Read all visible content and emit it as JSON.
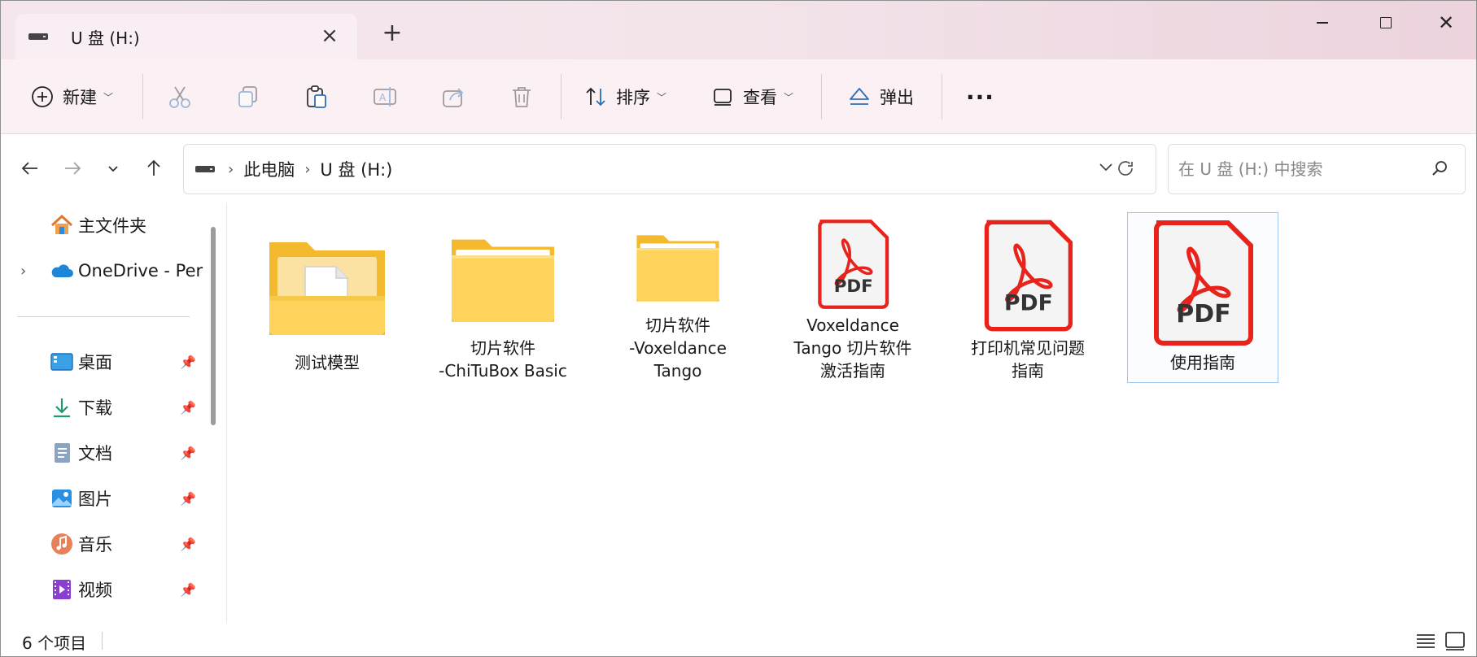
{
  "window": {
    "tab_title": "U 盘 (H:)",
    "icons": {
      "tab_close": "close-icon",
      "new_tab": "plus-icon"
    }
  },
  "toolbar": {
    "new_label": "新建",
    "sort_label": "排序",
    "view_label": "查看",
    "eject_label": "弹出",
    "more_label": "···",
    "icons": [
      "plus-circle-icon",
      "cut-icon",
      "copy-icon",
      "paste-icon",
      "rename-icon",
      "share-icon",
      "delete-icon",
      "sort-icon",
      "view-icon",
      "eject-icon",
      "more-icon"
    ]
  },
  "address": {
    "crumbs": [
      "此电脑",
      "U 盘 (H:)"
    ],
    "search_placeholder": "在 U 盘 (H:) 中搜索"
  },
  "sidebar": {
    "items": [
      {
        "label": "主文件夹",
        "icon": "home-icon",
        "pinned": false
      },
      {
        "label": "OneDrive - Per",
        "icon": "cloud-icon",
        "pinned": false
      },
      {
        "label": "桌面",
        "icon": "desktop-icon",
        "pinned": true
      },
      {
        "label": "下载",
        "icon": "download-icon",
        "pinned": true
      },
      {
        "label": "文档",
        "icon": "document-icon",
        "pinned": true
      },
      {
        "label": "图片",
        "icon": "pictures-icon",
        "pinned": true
      },
      {
        "label": "音乐",
        "icon": "music-icon",
        "pinned": true
      },
      {
        "label": "视频",
        "icon": "video-icon",
        "pinned": true
      }
    ],
    "pin_glyph": "📌"
  },
  "files": [
    {
      "name_lines": [
        "测试模型"
      ],
      "type": "folder-with-file"
    },
    {
      "name_lines": [
        "切片软件",
        "-ChiTuBox Basic"
      ],
      "type": "folder"
    },
    {
      "name_lines": [
        "切片软件",
        "-Voxeldance",
        "Tango"
      ],
      "type": "folder"
    },
    {
      "name_lines": [
        "Voxeldance",
        "Tango 切片软件",
        "激活指南"
      ],
      "type": "pdf"
    },
    {
      "name_lines": [
        "打印机常见问题",
        "指南"
      ],
      "type": "pdf"
    },
    {
      "name_lines": [
        "使用指南"
      ],
      "type": "pdf",
      "selected": true
    }
  ],
  "pdf_label": "PDF",
  "status": {
    "item_count": "6 个项目"
  },
  "colors": {
    "accent": "#0067c0",
    "pdf_red": "#e8231b",
    "folder_yellow": "#f7c948"
  }
}
